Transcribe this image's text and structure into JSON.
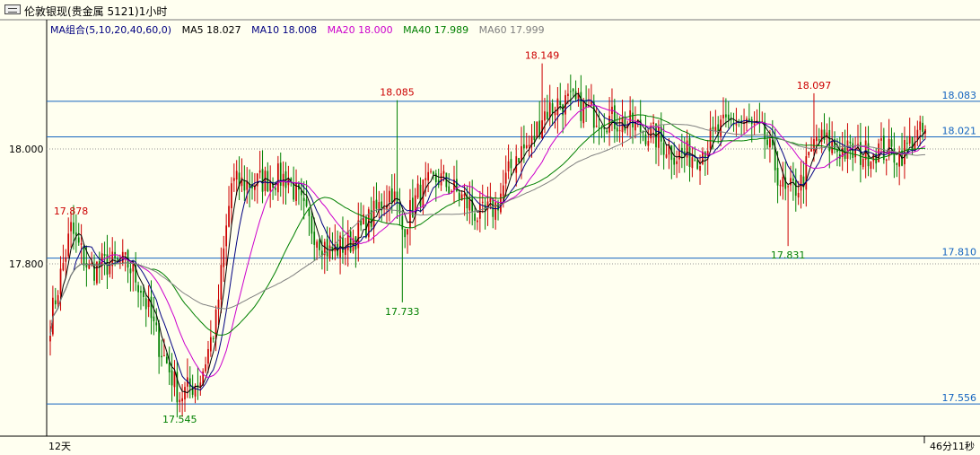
{
  "window": {
    "title": "伦敦银现(贵金属 5121)1小时",
    "icon": "window-icon"
  },
  "legend": {
    "group_label": "MA组合(5,10,20,40,60,0)",
    "items": [
      {
        "label": "MA5 18.027",
        "color": "#000000"
      },
      {
        "label": "MA10 18.008",
        "color": "#000080"
      },
      {
        "label": "MA20 18.000",
        "color": "#cc00cc"
      },
      {
        "label": "MA40 17.989",
        "color": "#008000"
      },
      {
        "label": "MA60 17.999",
        "color": "#808080"
      }
    ]
  },
  "footer": {
    "left": "12天",
    "right": "46分11秒"
  },
  "chart_data": {
    "type": "candlestick",
    "ylim": [
      17.5,
      18.2
    ],
    "y_ticks": [
      {
        "value": 18.0,
        "label": "18.000"
      },
      {
        "value": 17.8,
        "label": "17.800"
      }
    ],
    "hlines": [
      {
        "value": 18.083,
        "label": "18.083"
      },
      {
        "value": 18.021,
        "label": "18.021"
      },
      {
        "value": 17.81,
        "label": "17.810"
      },
      {
        "value": 17.556,
        "label": "17.556"
      }
    ],
    "annotations": [
      {
        "label": "17.878",
        "value": 17.878,
        "index": 8,
        "color": "#cc0000"
      },
      {
        "label": "17.545",
        "value": 17.545,
        "index": 50,
        "color": "#008000"
      },
      {
        "label": "18.085",
        "value": 18.085,
        "index": 134,
        "color": "#cc0000"
      },
      {
        "label": "17.733",
        "value": 17.733,
        "index": 136,
        "color": "#008000"
      },
      {
        "label": "18.149",
        "value": 18.149,
        "index": 190,
        "color": "#cc0000"
      },
      {
        "label": "18.097",
        "value": 18.097,
        "index": 295,
        "color": "#cc0000"
      },
      {
        "label": "17.831",
        "value": 17.831,
        "index": 285,
        "color": "#008000"
      }
    ],
    "anchors": [
      [
        0,
        17.7
      ],
      [
        8,
        17.86
      ],
      [
        15,
        17.79
      ],
      [
        22,
        17.8
      ],
      [
        30,
        17.8
      ],
      [
        35,
        17.76
      ],
      [
        42,
        17.66
      ],
      [
        50,
        17.57
      ],
      [
        58,
        17.6
      ],
      [
        64,
        17.7
      ],
      [
        70,
        17.94
      ],
      [
        78,
        17.94
      ],
      [
        86,
        17.95
      ],
      [
        92,
        17.95
      ],
      [
        100,
        17.87
      ],
      [
        108,
        17.82
      ],
      [
        116,
        17.84
      ],
      [
        124,
        17.88
      ],
      [
        132,
        17.93
      ],
      [
        136,
        17.86
      ],
      [
        142,
        17.92
      ],
      [
        150,
        17.95
      ],
      [
        158,
        17.92
      ],
      [
        166,
        17.88
      ],
      [
        172,
        17.9
      ],
      [
        180,
        17.99
      ],
      [
        186,
        18.01
      ],
      [
        190,
        18.06
      ],
      [
        196,
        18.08
      ],
      [
        202,
        18.08
      ],
      [
        210,
        18.06
      ],
      [
        218,
        18.05
      ],
      [
        226,
        18.04
      ],
      [
        234,
        18.02
      ],
      [
        242,
        17.99
      ],
      [
        250,
        17.99
      ],
      [
        258,
        18.03
      ],
      [
        264,
        18.05
      ],
      [
        270,
        18.04
      ],
      [
        276,
        18.02
      ],
      [
        284,
        17.92
      ],
      [
        290,
        17.94
      ],
      [
        296,
        18.02
      ],
      [
        304,
        18.0
      ],
      [
        312,
        17.99
      ],
      [
        320,
        18.0
      ],
      [
        328,
        17.99
      ],
      [
        334,
        18.02
      ],
      [
        338,
        18.03
      ]
    ],
    "candle_count": 339
  }
}
